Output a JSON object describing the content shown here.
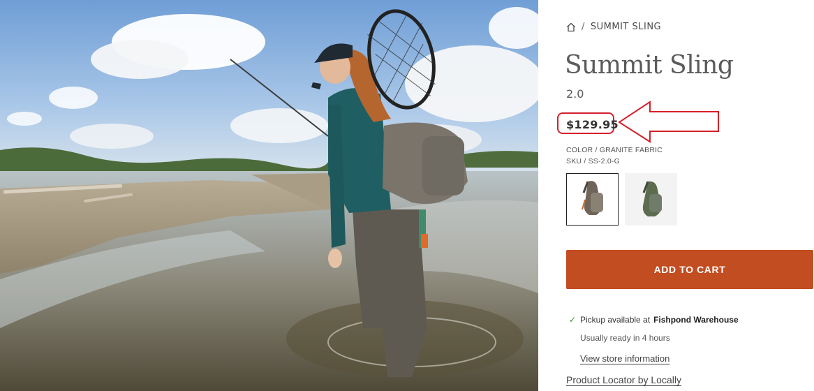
{
  "breadcrumb": {
    "home_icon": "home-icon",
    "separator": "/",
    "current": "SUMMIT SLING"
  },
  "product": {
    "title": "Summit Sling",
    "version": "2.0",
    "price": "$129.95",
    "color_label": "COLOR",
    "color_value": "GRANITE FABRIC",
    "sku_label": "SKU",
    "sku_value": "SS-2.0-G",
    "meta_separator": "/",
    "swatches": [
      {
        "name": "granite",
        "selected": true,
        "color": "#6e6558"
      },
      {
        "name": "green",
        "selected": false,
        "color": "#5d6b4e"
      }
    ]
  },
  "cart": {
    "add_label": "ADD TO CART",
    "button_color": "#c24d21"
  },
  "pickup": {
    "prefix": "Pickup available at",
    "store": "Fishpond Warehouse",
    "ready": "Usually ready in 4 hours",
    "store_info_link": "View store information",
    "locator_link": "Product Locator by Locally"
  },
  "annotation": {
    "highlight_color": "#d4202b"
  }
}
